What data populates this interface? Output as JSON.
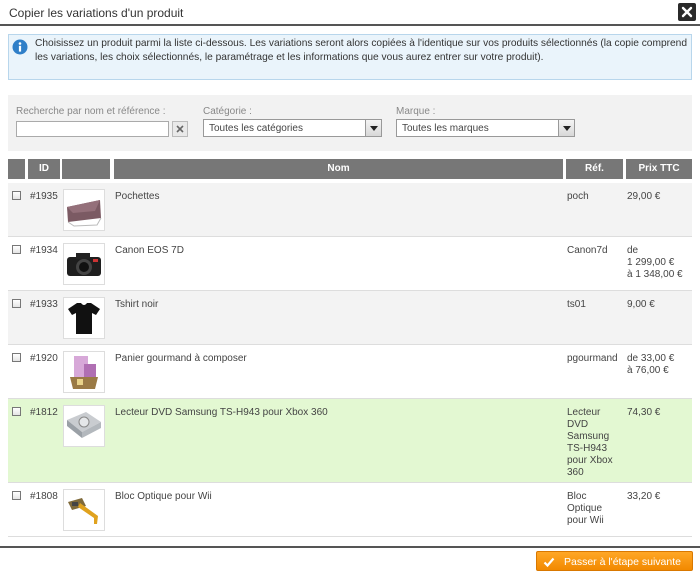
{
  "dialog": {
    "title": "Copier les variations d'un produit",
    "close_icon": "close-icon"
  },
  "info": {
    "icon": "info-icon",
    "text": "Choisissez un produit parmi la liste ci-dessous. Les variations seront alors copiées à l'identique sur vos produits sélectionnés (la copie comprend les variations, les choix sélectionnés, le paramétrage et les informations que vous aurez entrer sur votre produit)."
  },
  "filters": {
    "search_label": "Recherche par nom et référence :",
    "search_value": "",
    "category_label": "Catégorie :",
    "category_value": "Toutes les catégories",
    "brand_label": "Marque :",
    "brand_value": "Toutes les marques"
  },
  "table": {
    "headers": {
      "id": "ID",
      "name": "Nom",
      "ref": "Réf.",
      "price": "Prix TTC"
    },
    "rows": [
      {
        "id": "#1935",
        "name": "Pochettes",
        "ref": "poch",
        "price": "29,00 €",
        "thumb": "clutch-bag-thumbnail",
        "selected": false
      },
      {
        "id": "#1934",
        "name": "Canon EOS 7D",
        "ref": "Canon7d",
        "price": "de\n1 299,00 €\nà 1 348,00 €",
        "thumb": "camera-thumbnail",
        "selected": false
      },
      {
        "id": "#1933",
        "name": "Tshirt noir",
        "ref": "ts01",
        "price": "9,00 €",
        "thumb": "tshirt-thumbnail",
        "selected": false
      },
      {
        "id": "#1920",
        "name": "Panier gourmand à composer",
        "ref": "pgourmand",
        "price": "de 33,00 €\nà 76,00 €",
        "thumb": "gift-basket-thumbnail",
        "selected": false
      },
      {
        "id": "#1812",
        "name": "Lecteur DVD Samsung TS-H943 pour Xbox 360",
        "ref": "Lecteur\nDVD\nSamsung\nTS-H943\npour Xbox\n360",
        "price": "74,30 €",
        "thumb": "dvd-drive-thumbnail",
        "selected": true
      },
      {
        "id": "#1808",
        "name": "Bloc Optique pour Wii",
        "ref": "Bloc\nOptique\npour Wii",
        "price": "33,20 €",
        "thumb": "optical-block-thumbnail",
        "selected": false
      }
    ]
  },
  "footer": {
    "next_label": "Passer à l'étape suivante",
    "next_icon": "checkmark-icon",
    "accent": "#f28900"
  }
}
